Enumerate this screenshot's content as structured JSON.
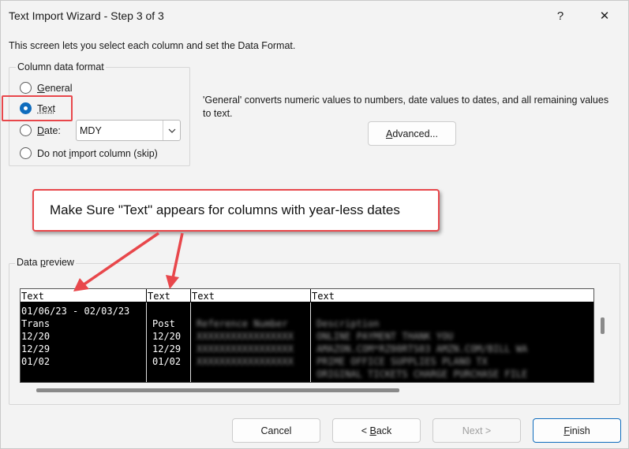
{
  "window": {
    "title": "Text Import Wizard - Step 3 of 3",
    "help_label": "?",
    "close_label": "✕"
  },
  "intro_text": "This screen lets you select each column and set the Data Format.",
  "format_group": {
    "label": "Column data format",
    "options": [
      {
        "label": "General",
        "checked": false
      },
      {
        "label": "Text",
        "checked": true
      },
      {
        "label": "Date:",
        "checked": false
      },
      {
        "label": "Do not import column (skip)",
        "checked": false
      }
    ],
    "date_value": "MDY"
  },
  "description": "'General' converts numeric values to numbers, date values to dates, and all remaining values to text.",
  "advanced_label": "Advanced...",
  "callout_text": "Make Sure \"Text\" appears for columns with year-less dates",
  "preview": {
    "label": "Data preview",
    "columns": [
      "Text",
      "Text",
      "Text",
      "Text"
    ],
    "col1": [
      "01/06/23 - 02/03/23",
      "Trans",
      "12/20",
      "12/29",
      "01/02"
    ],
    "col2": [
      "",
      "Post",
      "12/20",
      "12/29",
      "01/02"
    ],
    "col3": [
      "",
      "Reference Number",
      "XXXXXXXXXXXXXXXXX",
      "XXXXXXXXXXXXXXXXX",
      "XXXXXXXXXXXXXXXXX"
    ],
    "col4": [
      "",
      "Description",
      "ONLINE PAYMENT THANK YOU",
      "AMAZON.COM*RZ00RTS03 AMZN.COM/BILL WA",
      "PRIME OFFICE SUPPLIES PLANO TX",
      "ORIGINAL TICKETS CHARGE PURCHASE FILE"
    ]
  },
  "buttons": {
    "cancel": "Cancel",
    "back": "< Back",
    "next": "Next >",
    "finish": "Finish"
  },
  "colors": {
    "accent": "#0f6cbd",
    "annotation": "#e8474b"
  }
}
